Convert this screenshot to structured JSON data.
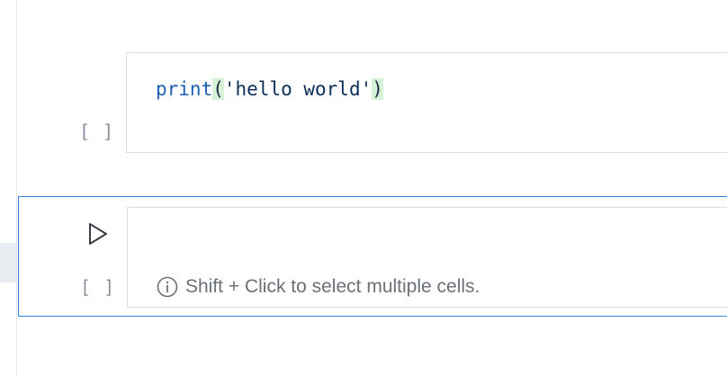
{
  "cells": [
    {
      "execution_count": "[ ]",
      "code": {
        "func": "print",
        "open_paren": "(",
        "string": "'hello world'",
        "close_paren": ")"
      }
    },
    {
      "execution_count": "[ ]",
      "hint_text": "Shift + Click to select multiple cells."
    }
  ],
  "icons": {
    "run": "play-triangle-icon",
    "hint": "info-circle-icon"
  },
  "colors": {
    "selected_border": "#2f84e0",
    "bracket_match_bg": "#d4f3d6",
    "function_name": "#1a5fb4"
  }
}
